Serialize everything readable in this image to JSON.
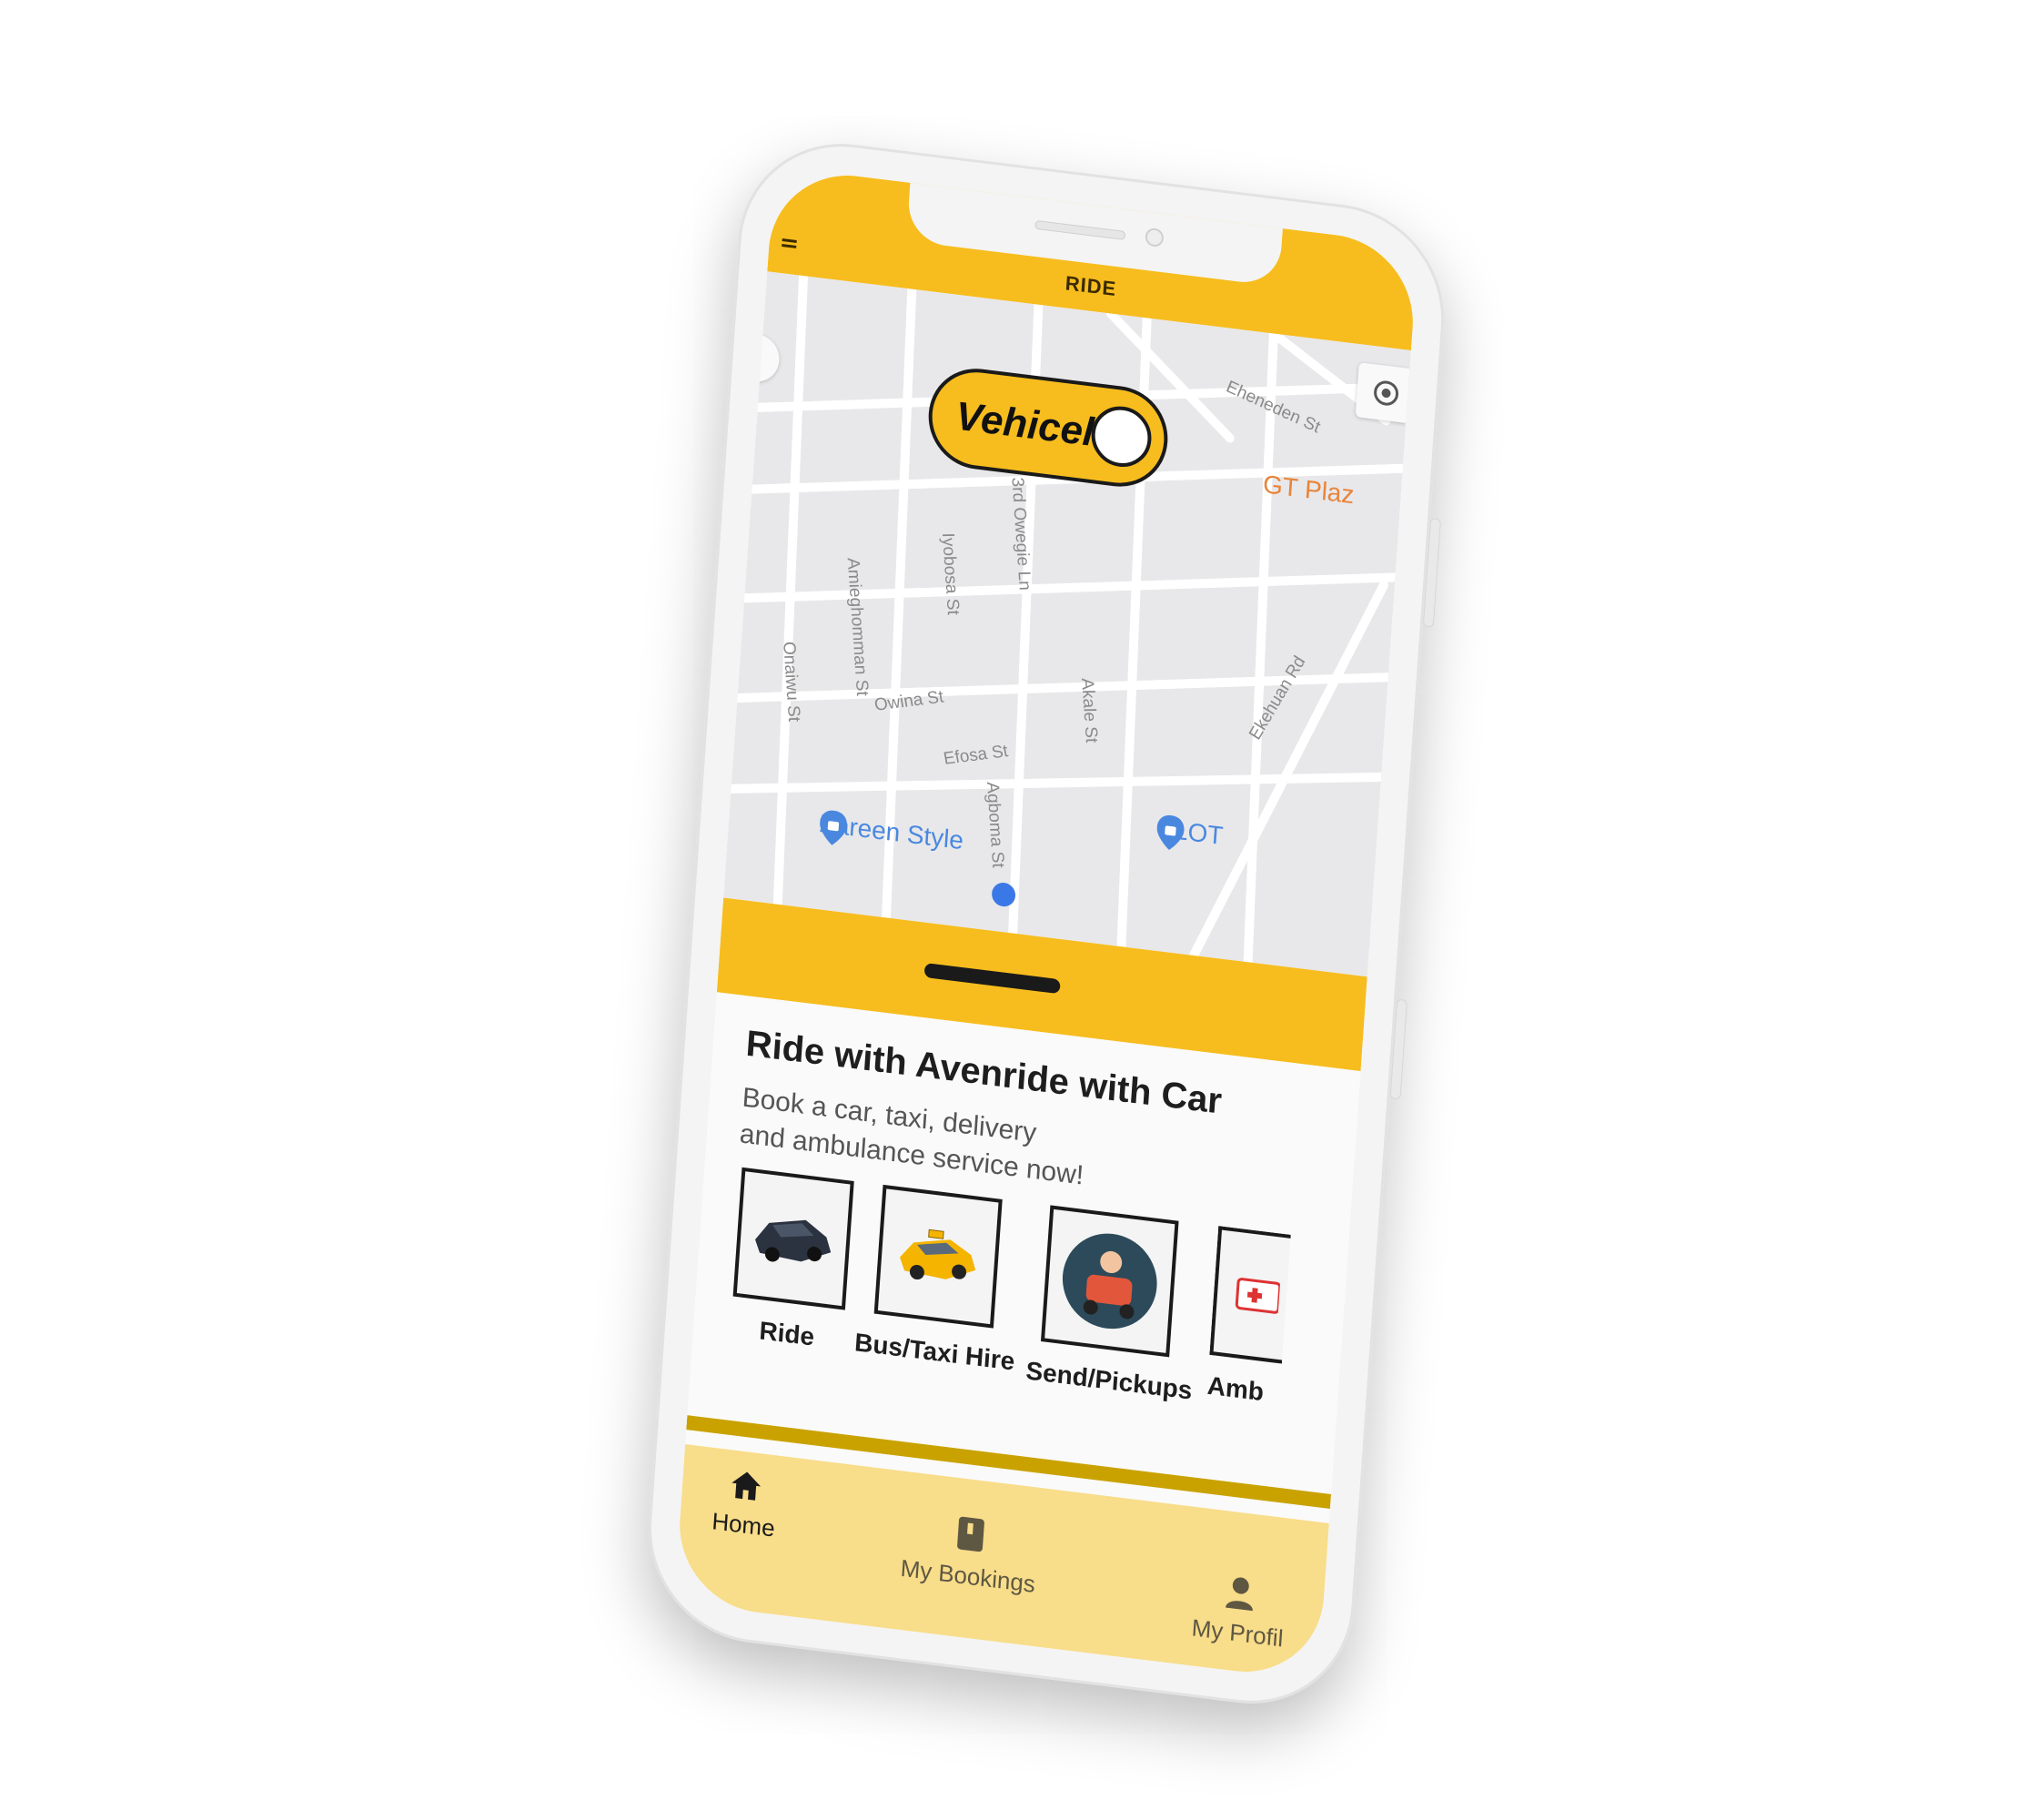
{
  "app": {
    "logo_text": "RIDE",
    "colors": {
      "brand": "#f7bd1e",
      "nav_bg": "#f8dd8a",
      "divider": "#c9a200"
    }
  },
  "map": {
    "vehicle_toggle_label": "Vehicel",
    "streets": [
      "Eheneden St",
      "3rd Owegie Ln",
      "Iyobosa St",
      "Amieghomman St",
      "Onaiwu St",
      "Owina St",
      "Efosa St",
      "Agboma St",
      "Akale St",
      "Ekehuan Rd"
    ],
    "pois": {
      "gt_plaza": "GT Plaz",
      "zareen": "Zareen Style",
      "slot": "SLOT"
    }
  },
  "promo": {
    "title": "Ride with Avenride with Car",
    "subtitle_line1": "Book a car, taxi, delivery",
    "subtitle_line2": "and ambulance service now!"
  },
  "services": [
    {
      "label": "Ride",
      "icon": "car-icon"
    },
    {
      "label": "Bus/Taxi Hire",
      "icon": "taxi-icon"
    },
    {
      "label": "Send/Pickups",
      "icon": "courier-icon"
    },
    {
      "label": "Amb",
      "icon": "ambulance-icon"
    }
  ],
  "nav": [
    {
      "label": "Home",
      "icon": "home-icon",
      "active": true
    },
    {
      "label": "My Bookings",
      "icon": "bookmark-icon",
      "active": false
    },
    {
      "label": "My Profil",
      "icon": "profile-icon",
      "active": false
    }
  ]
}
